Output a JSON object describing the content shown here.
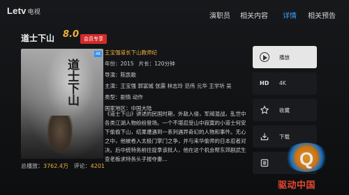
{
  "brand": {
    "logo": "Letv",
    "logo_sub": "电视"
  },
  "nav": {
    "tabs": [
      {
        "label": "演职员",
        "active": false
      },
      {
        "label": "相关内容",
        "active": false
      },
      {
        "label": "详情",
        "active": true
      },
      {
        "label": "相关预告",
        "active": false
      }
    ]
  },
  "movie": {
    "title": "道士下山",
    "rating": "8.0",
    "badge": "会员专享",
    "poster_title": "道士下山",
    "poster_badge": "4K",
    "highlight": "王宝强道长下山教师纪",
    "year_label": "年份：",
    "year": "2015",
    "duration_label": "片长：",
    "duration": "120分钟",
    "director_label": "导演：",
    "director": "陈凯歌",
    "cast_label": "主演：",
    "cast": "王宝强 郭富城 张震 林志玲 范伟 元华 王学圻 吴",
    "genre_label": "类型：",
    "genre": "剧情 动作",
    "region_label": "国家地区：",
    "region": "中国大陆",
    "description": "《道士下山》讲述的民国时期，外敌入侵，军阀混战，乱世中各类江湖人物纷纷登场。一个不堪忍受山中寂寞的小道士何安下偷偷下山，结果遭遇到一系列遇异奇幻的人物和事件。无心之中，他被卷入太极门掌门之争，并与来华偷师的日本忍者对决。后中统特务前往捉拿该批人，他在这个机会帮东郊剧武生查老板求特务头子报夺妻..."
  },
  "stats": {
    "plays_label": "总播放：",
    "plays": "3762.4万",
    "comments_label": "评论：",
    "comments": "4201"
  },
  "actions": [
    {
      "icon": "play-icon",
      "label": "播放"
    },
    {
      "icon": "hd-icon",
      "icon_text": "HD",
      "label": "4K"
    },
    {
      "icon": "star-icon",
      "label": "收藏"
    },
    {
      "icon": "download-icon",
      "label": "下载"
    },
    {
      "icon": "more-icon",
      "label": ""
    }
  ],
  "watermark": {
    "text": "驱动中国"
  },
  "colors": {
    "accent": "#3aa1ff",
    "rating": "#f0b23b",
    "badge": "#d12b2b"
  }
}
